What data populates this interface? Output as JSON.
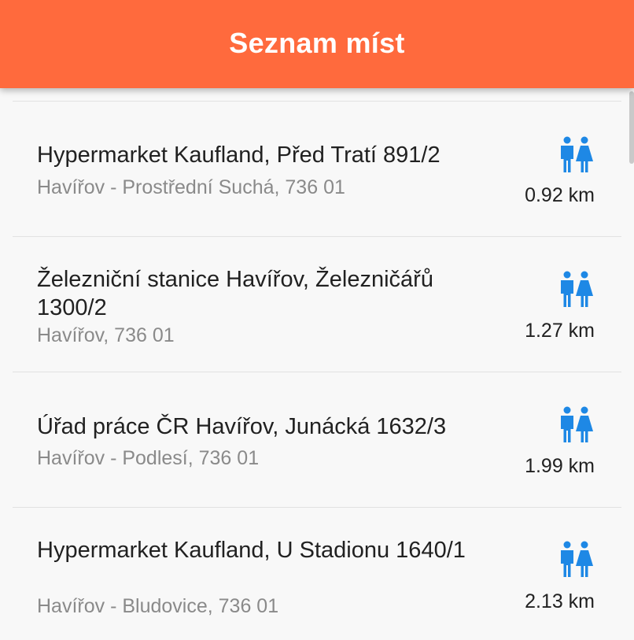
{
  "header": {
    "title": "Seznam míst"
  },
  "colors": {
    "accent": "#ff6a3d",
    "icon": "#1e88e5"
  },
  "places": [
    {
      "name": "Hypermarket Kaufland, Před Tratí 891/2",
      "address": "Havířov - Prostřední Suchá, 736 01",
      "distance": "0.92 km",
      "icon": "restroom-icon"
    },
    {
      "name": "Železniční stanice Havířov, Železničářů 1300/2",
      "address": "Havířov, 736 01",
      "distance": "1.27 km",
      "icon": "restroom-icon"
    },
    {
      "name": "Úřad práce ČR Havířov, Junácká 1632/3",
      "address": "Havířov - Podlesí, 736 01",
      "distance": "1.99 km",
      "icon": "restroom-icon"
    },
    {
      "name": "Hypermarket Kaufland, U Stadionu 1640/1",
      "address": "Havířov - Bludovice, 736 01",
      "distance": "2.13 km",
      "icon": "restroom-icon"
    }
  ]
}
